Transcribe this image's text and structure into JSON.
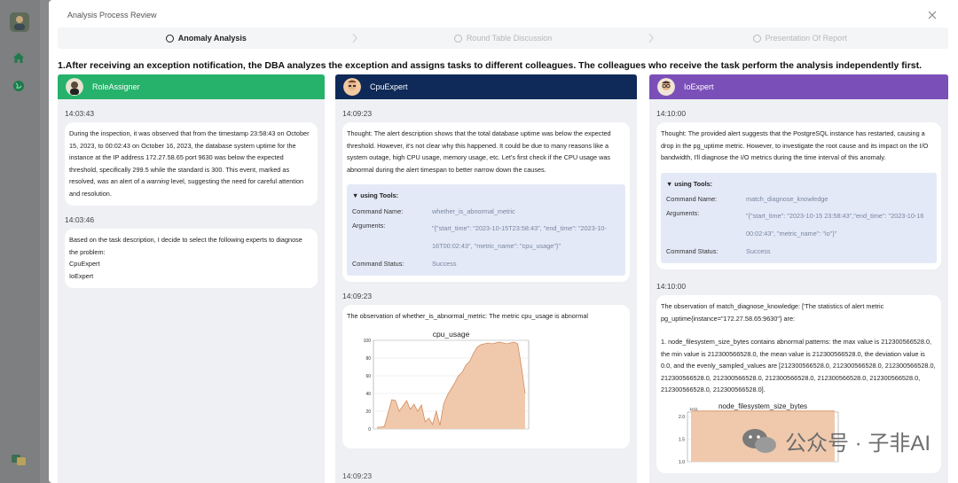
{
  "modal": {
    "title": "Analysis Process Review",
    "steps": [
      {
        "label": "Anomaly Analysis",
        "active": true
      },
      {
        "label": "Round Table Discussion",
        "active": false
      },
      {
        "label": "Presentation Of Report",
        "active": false
      }
    ],
    "headline": "1.After receiving an exception notification, the DBA analyzes the exception and assigns tasks to different colleagues. The colleagues who receive the task perform the analysis independently first."
  },
  "agents": [
    {
      "name": "RoleAssigner",
      "messages": [
        {
          "time": "14:03:43",
          "text_before": "During the inspection, it was observed that from the timestamp 23:58:43 on October 15, 2023, to 00:02:43 on October 16, 2023, the database system uptime for the instance at the IP address 172.27.58.65 port 9630 was below the expected threshold, specifically 299.5 while the standard is 300. This event, marked as resolved, was an alert of a ",
          "text_em": "warning",
          "text_after": " level, suggesting the need for careful attention and resolution."
        },
        {
          "time": "14:03:46",
          "lines": [
            "Based on the task description, I decide to select the following experts to diagnose the problem:",
            "CpuExpert",
            "IoExpert"
          ]
        }
      ]
    },
    {
      "name": "CpuExpert",
      "messages": [
        {
          "time": "14:09:23",
          "text": "Thought: The alert description shows that the total database uptime was below the expected threshold. However, it's not clear why this happened. It could be due to many reasons like a system outage, high CPU usage, memory usage, etc. Let's first check if the CPU usage was abnormal during the alert timespan to better narrow down the causes.",
          "tools": {
            "title": "▼ using Tools:",
            "command_label": "Command Name:",
            "command": "whether_is_abnormal_metric",
            "args_label": "Arguments:",
            "args": "\"{\"start_time\": \"2023-10-15T23:58:43\", \"end_time\": \"2023-10-16T00:02:43\", \"metric_name\": \"cpu_usage\"}\"",
            "status_label": "Command Status:",
            "status": "Success"
          }
        },
        {
          "time": "14:09:23",
          "text": "The observation of whether_is_abnormal_metric: The metric cpu_usage is abnormal"
        },
        {
          "time": "14:09:23"
        }
      ]
    },
    {
      "name": "IoExpert",
      "messages": [
        {
          "time": "14:10:00",
          "text": "Thought: The provided alert suggests that the PostgreSQL instance has restarted, causing a drop in the pg_uptime metric. However, to investigate the root cause and its impact on the I/O bandwidth, I'll diagnose the I/O metrics during the time interval of this anomaly.",
          "tools": {
            "title": "▼ using Tools:",
            "command_label": "Command Name:",
            "command": "match_diagnose_knowledge",
            "args_label": "Arguments:",
            "args": "\"{\"start_time\": \"2023-10-15 23:58:43\",\"end_time\": \"2023-10-16 00:02:43\", \"metric_name\": \"io\"}\"",
            "status_label": "Command Status:",
            "status": "Success"
          }
        },
        {
          "time": "14:10:00",
          "text": "The observation of match_diagnose_knowledge: ['The statistics of alert metric pg_uptime{instance=\"172.27.58.65:9630\"} are:",
          "text2": "1. node_filesystem_size_bytes contains abnormal patterns: the max value is 212300566528.0, the min value is 212300566528.0, the mean value is 212300566528.0, the deviation value is 0.0, and the evenly_sampled_values are [212300566528.0, 212300566528.0, 212300566528.0, 212300566528.0, 212300566528.0, 212300566528.0, 212300566528.0, 212300566528.0, 212300566528.0, 212300566528.0]."
        }
      ]
    }
  ],
  "watermark": {
    "text": "公众号 · 子非AI"
  },
  "chart_data": [
    {
      "type": "area",
      "title": "cpu_usage",
      "xlabel": "",
      "ylabel": "",
      "ylim": [
        0,
        100
      ],
      "yticks": [
        "0",
        "20",
        "40",
        "60",
        "80",
        "100"
      ],
      "grid": true,
      "color": "#f0c9ad",
      "line_color": "#d48a5c",
      "values": [
        2,
        2,
        3,
        18,
        33,
        32,
        20,
        26,
        32,
        22,
        28,
        20,
        27,
        8,
        12,
        5,
        20,
        4,
        28,
        38,
        45,
        52,
        60,
        64,
        72,
        76,
        85,
        92,
        95,
        96,
        97,
        96,
        97,
        98,
        97,
        96,
        97,
        98,
        96,
        70,
        40
      ]
    },
    {
      "type": "area",
      "title": "node_filesystem_size_bytes",
      "scale_label": "1e11",
      "yticks": [
        "1.0",
        "1.5",
        "2.0"
      ],
      "ylim": [
        1.0,
        2.1
      ],
      "grid": true,
      "color": "#f0c9ad",
      "line_color": "#d48a5c",
      "values": [
        2.123,
        2.123,
        2.123,
        2.123,
        2.123,
        2.123,
        2.123,
        2.123,
        2.123,
        2.123
      ]
    }
  ],
  "colors": {
    "role_assigner": "#26b26b",
    "cpu_expert": "#0f2a59",
    "io_expert": "#7b4fb8",
    "tool_bg": "#e3e9f6"
  }
}
